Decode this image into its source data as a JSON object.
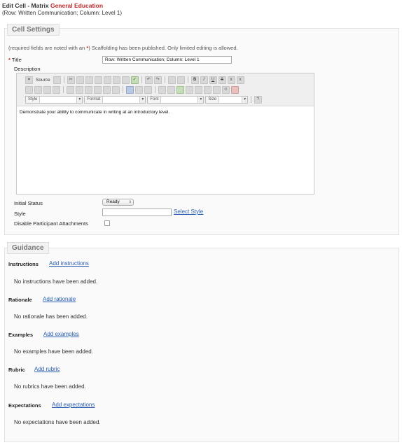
{
  "header": {
    "title_prefix": "Edit Cell - Matrix ",
    "title_matrix": "General Education",
    "subtitle": "(Row: Written Communication; Column: Level 1)"
  },
  "cell_settings": {
    "legend": "Cell Settings",
    "note_prefix": "(required fields are noted with an ",
    "note_star": "*",
    "note_suffix": ") Scaffolding has been published. Only limited editing is allowed.",
    "title_label": "Title",
    "title_required": "*",
    "title_value": "Row: Written Communication; Column: Level 1",
    "description_label": "Description",
    "editor": {
      "source_label": "Source",
      "style_label": "Style",
      "format_label": "Format",
      "font_label": "Font",
      "size_label": "Size",
      "content": "Demonstrate your ability to communicate in writing at an introductory level."
    },
    "initial_status_label": "Initial Status",
    "initial_status_value": "Ready",
    "style_label": "Style",
    "style_value": "",
    "select_style_link": "Select Style",
    "disable_attachments_label": "Disable Participant Attachments",
    "disable_attachments_checked": false
  },
  "guidance": {
    "legend": "Guidance",
    "sections": [
      {
        "label": "Instructions",
        "link": "Add instructions",
        "empty": "No instructions have been added."
      },
      {
        "label": "Rationale",
        "link": "Add rationale",
        "empty": "No rationale has been added."
      },
      {
        "label": "Examples",
        "link": "Add examples",
        "empty": "No examples have been added."
      },
      {
        "label": "Rubric",
        "link": "Add rubric",
        "empty": "No rubrics have been added."
      },
      {
        "label": "Expectations",
        "link": "Add expectations",
        "empty": "No expectations have been added."
      }
    ]
  },
  "colors": {
    "accent": "#c0282b",
    "link": "#2a5db0"
  }
}
